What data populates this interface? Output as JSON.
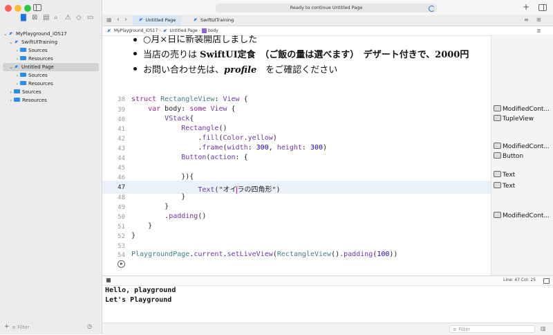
{
  "status": {
    "text": "Ready to continue Untitled Page"
  },
  "tabs": [
    {
      "label": "Untitled Page"
    },
    {
      "label": "SwiftUITraining"
    }
  ],
  "breadcrumb": [
    {
      "label": "MyPlayground_iOS17"
    },
    {
      "label": "Untitled Page"
    },
    {
      "label": "body"
    }
  ],
  "sidebar": {
    "items": [
      {
        "label": "MyPlayground_iOS17"
      },
      {
        "label": "SwiftUITraining"
      },
      {
        "label": "Sources"
      },
      {
        "label": "Resources"
      },
      {
        "label": "Untitled Page"
      },
      {
        "label": "Sources"
      },
      {
        "label": "Resources"
      },
      {
        "label": "Sources"
      },
      {
        "label": "Resources"
      }
    ],
    "filter_placeholder": "Filter"
  },
  "doc": {
    "line1": "○月×日に新装開店しました",
    "line2_a": "当店の売りは ",
    "line2_b": "SwiftUI定食",
    "line2_c": "　（ご飯の量は選べます）　デザート付きで、2000円",
    "line3_a": "お問い合わせ先は、",
    "line3_b": "profile",
    "line3_c": "　をご確認ください"
  },
  "code": {
    "line_numbers": [
      "38",
      "39",
      "40",
      "41",
      "42",
      "43",
      "44",
      "45",
      "46",
      "47",
      "48",
      "49",
      "50",
      "51",
      "52",
      "53",
      "54"
    ]
  },
  "results": [
    "ModifiedCont...",
    "TupleView",
    "ModifiedCont...",
    "Button",
    "Text",
    "Text",
    "ModifiedCont..."
  ],
  "console": {
    "cursor": "Line: 47  Col: 25",
    "lines": [
      "Hello, playground",
      "Let's Playground"
    ]
  },
  "bottom": {
    "filter_placeholder": "Filter"
  },
  "colors": {
    "accent": "#1d72e8",
    "keyword": "#9b2393",
    "type": "#3e7f8a",
    "number": "#1c00cf",
    "string": "#c41a16"
  }
}
